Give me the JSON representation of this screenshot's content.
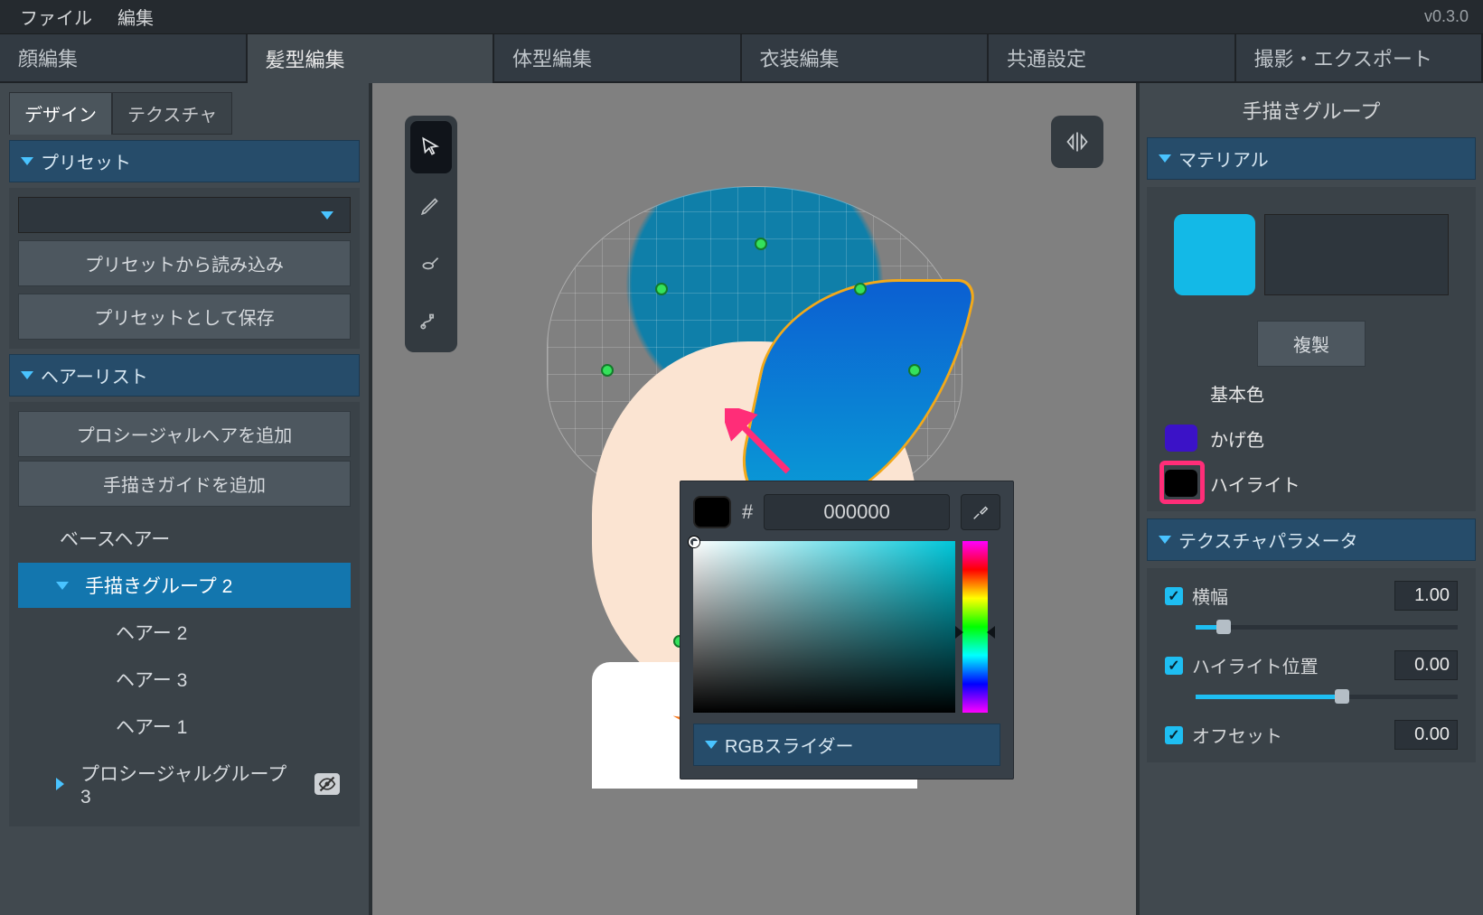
{
  "menubar": {
    "file": "ファイル",
    "edit": "編集",
    "version": "v0.3.0"
  },
  "maintabs": {
    "face": "顔編集",
    "hair": "髪型編集",
    "body": "体型編集",
    "clothes": "衣装編集",
    "common": "共通設定",
    "export": "撮影・エクスポート"
  },
  "left": {
    "subtabs": {
      "design": "デザイン",
      "texture": "テクスチャ"
    },
    "preset": {
      "header": "プリセット",
      "load": "プリセットから読み込み",
      "save": "プリセットとして保存"
    },
    "hairlist": {
      "header": "ヘアーリスト",
      "add_procedural": "プロシージャルヘアを追加",
      "add_guide": "手描きガイドを追加",
      "items": {
        "base": "ベースヘアー",
        "handgroup": "手描きグループ 2",
        "h2": "ヘアー 2",
        "h3": "ヘアー 3",
        "h1": "ヘアー 1",
        "procgroup": "プロシージャルグループ 3"
      }
    }
  },
  "colorpicker": {
    "hex": "000000",
    "rgbslider": "RGBスライダー"
  },
  "right": {
    "title": "手描きグループ",
    "material": {
      "header": "マテリアル",
      "duplicate": "複製",
      "base_color": {
        "label": "基本色",
        "hex": "#13b9e7"
      },
      "shade_color": {
        "label": "かげ色",
        "hex": "#3b12c7"
      },
      "highlight": {
        "label": "ハイライト",
        "hex": "#000000"
      }
    },
    "texparam": {
      "header": "テクスチャパラメータ",
      "width": {
        "label": "横幅",
        "value": "1.00"
      },
      "hlpos": {
        "label": "ハイライト位置",
        "value": "0.00"
      },
      "offset": {
        "label": "オフセット",
        "value": "0.00"
      }
    }
  }
}
